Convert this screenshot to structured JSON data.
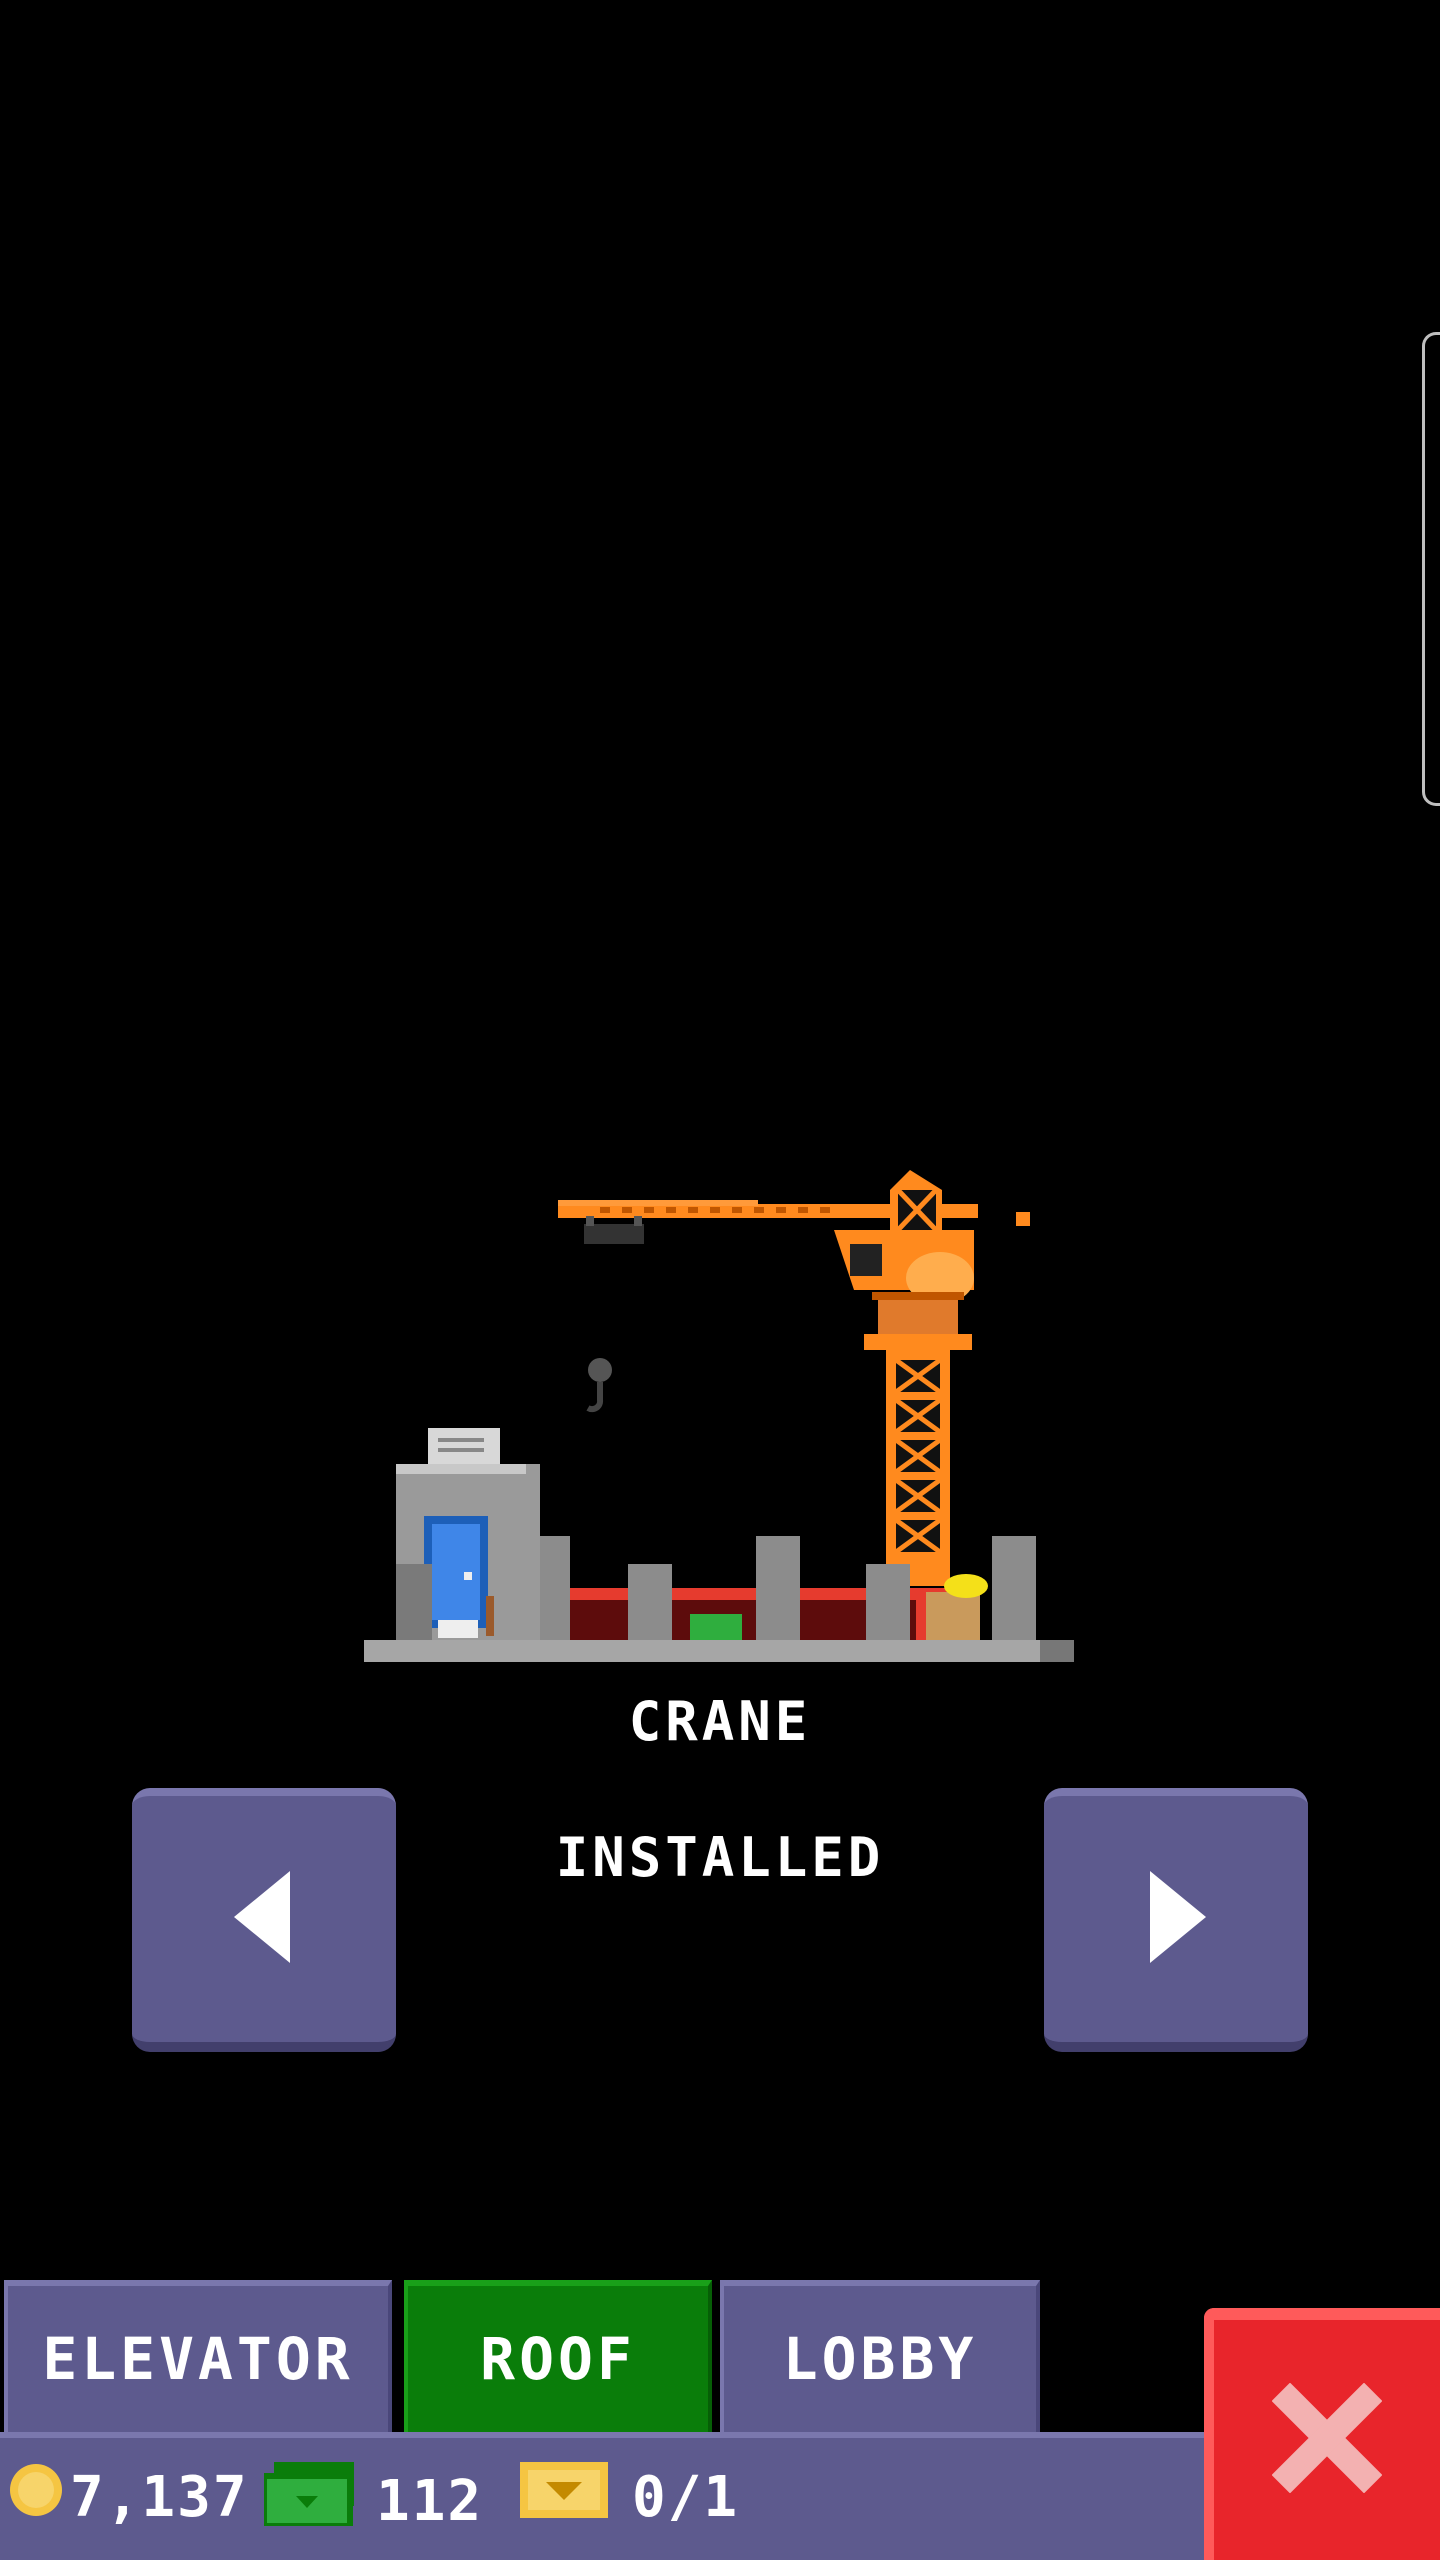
{
  "item": {
    "name": "CRANE",
    "status": "INSTALLED"
  },
  "tabs": [
    {
      "label": "ELEVATOR",
      "active": false
    },
    {
      "label": "ROOF",
      "active": true
    },
    {
      "label": "LOBBY",
      "active": false
    }
  ],
  "currency": {
    "coins": "7,137",
    "bux": "112",
    "tickets": "0/1"
  },
  "icons": {
    "prev": "arrow-left-icon",
    "next": "arrow-right-icon",
    "close": "close-icon",
    "coins": "coin-icon",
    "bux": "bux-icon",
    "tickets": "ticket-icon"
  },
  "colors": {
    "tab": "#5d5a8e",
    "tab_active": "#0a7d0a",
    "close": "#e8252b",
    "crane": "#ff8a1e"
  }
}
